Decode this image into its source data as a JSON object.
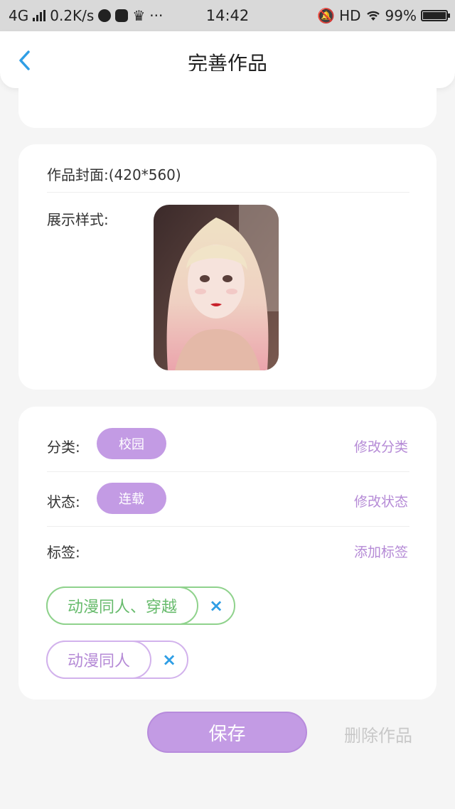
{
  "statusbar": {
    "network": "4G",
    "speed": "0.2K/s",
    "more": "···",
    "time": "14:42",
    "hd": "HD",
    "battery_level": 0.99,
    "battery": "99%"
  },
  "header": {
    "title": "完善作品"
  },
  "cover": {
    "label": "作品封面:",
    "size": "(420*560)",
    "style_label": "展示样式:"
  },
  "category": {
    "label": "分类:",
    "value": "校园",
    "action": "修改分类"
  },
  "status": {
    "label": "状态:",
    "value": "连载",
    "action": "修改状态"
  },
  "tags": {
    "label": "标签:",
    "action": "添加标签",
    "items": [
      {
        "text": "动漫同人、穿越",
        "remove": "×"
      },
      {
        "text": "动漫同人",
        "remove": "×"
      }
    ]
  },
  "footer": {
    "save": "保存",
    "delete": "删除作品"
  },
  "colors": {
    "accent": "#c39be4",
    "link": "#b58ad6",
    "close": "#2f9ee5",
    "tag_green": "#8fd28c"
  }
}
